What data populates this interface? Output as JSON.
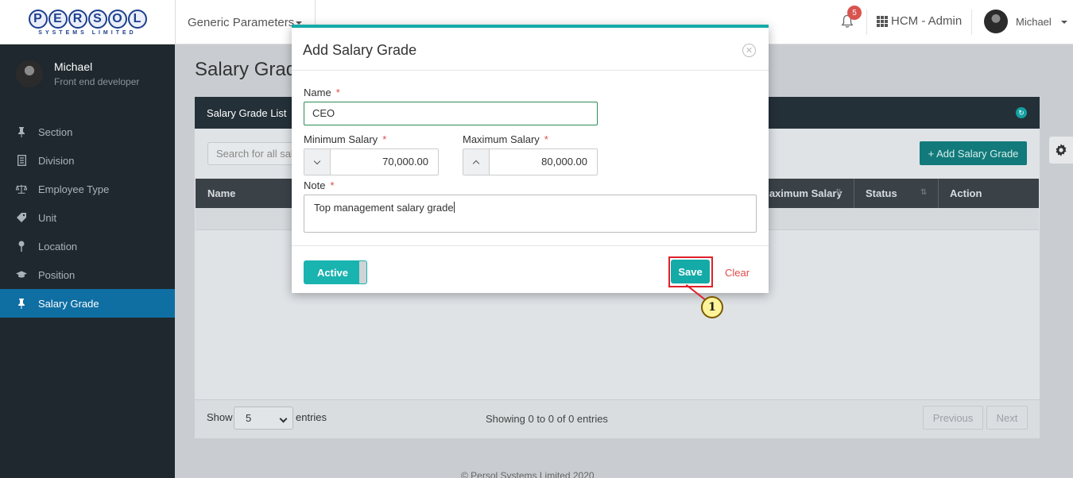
{
  "header": {
    "logo_letters": [
      "P",
      "E",
      "R",
      "S",
      "O",
      "L"
    ],
    "logo_sub": "SYSTEMS LIMITED",
    "menu_label": "Generic Parameters",
    "notification_count": "5",
    "app_label": "HCM - Admin",
    "user_name": "Michael"
  },
  "sidebar": {
    "profile_name": "Michael",
    "profile_role": "Front end developer",
    "items": [
      {
        "label": "Section",
        "icon": "pin-icon"
      },
      {
        "label": "Division",
        "icon": "document-icon"
      },
      {
        "label": "Employee Type",
        "icon": "balance-scale-icon"
      },
      {
        "label": "Unit",
        "icon": "tag-icon"
      },
      {
        "label": "Location",
        "icon": "map-pin-icon"
      },
      {
        "label": "Position",
        "icon": "graduation-cap-icon"
      },
      {
        "label": "Salary Grade",
        "icon": "pin-icon",
        "active": true
      }
    ]
  },
  "main": {
    "page_title": "Salary Grade",
    "card_title": "Salary Grade List",
    "search_placeholder": "Search for all salary",
    "add_button": "+ Add Salary Grade",
    "columns": [
      "Name",
      "Maximum Salary",
      "Status",
      "Action"
    ],
    "show_label": "Show",
    "page_size": "5",
    "entries_label": "entries",
    "showing_text": "Showing 0 to 0 of 0 entries",
    "prev_label": "Previous",
    "next_label": "Next",
    "copyright": "© Persol Systems Limited 2020"
  },
  "modal": {
    "title": "Add Salary Grade",
    "name_label": "Name",
    "name_value": "CEO",
    "min_label": "Minimum Salary",
    "min_value": "70,000.00",
    "max_label": "Maximum Salary",
    "max_value": "80,000.00",
    "note_label": "Note",
    "note_value": "Top management salary grade",
    "required_mark": "*",
    "status_toggle": "Active",
    "save_label": "Save",
    "clear_label": "Clear"
  },
  "annotation": {
    "step_number": "1",
    "highlight_color": "#e0202a"
  },
  "colors": {
    "accent": "#14aaa8",
    "sidebar_bg": "#1f282e",
    "sidebar_active": "#0f6fa3"
  }
}
